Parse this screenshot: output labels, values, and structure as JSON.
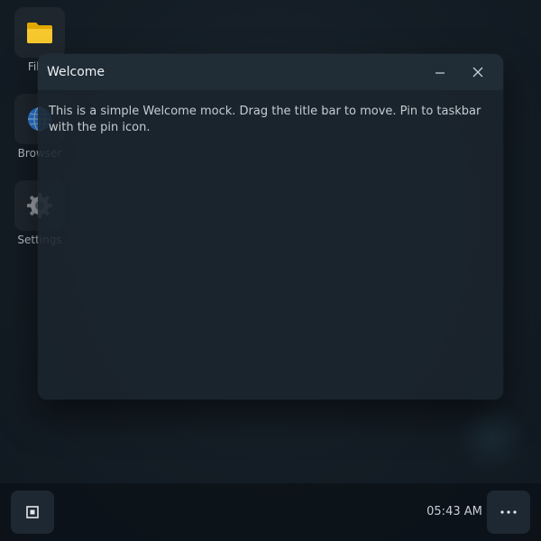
{
  "desktop": {
    "icons": [
      {
        "label": "Files",
        "icon": "folder-icon"
      },
      {
        "label": "Browser",
        "icon": "globe-icon"
      },
      {
        "label": "Settings",
        "icon": "gear-icon"
      }
    ]
  },
  "window": {
    "title": "Welcome",
    "body": "This is a simple Welcome mock. Drag the title bar to move. Pin to taskbar with the pin icon.",
    "minimize_icon": "minimize-icon",
    "close_icon": "close-icon"
  },
  "taskbar": {
    "start_icon": "start-square-icon",
    "clock": "05:43 AM",
    "overflow_icon": "more-dots-icon"
  },
  "colors": {
    "folder": "#f5c518",
    "globe": "#2e7bd6",
    "gear": "#9aa1a8"
  }
}
